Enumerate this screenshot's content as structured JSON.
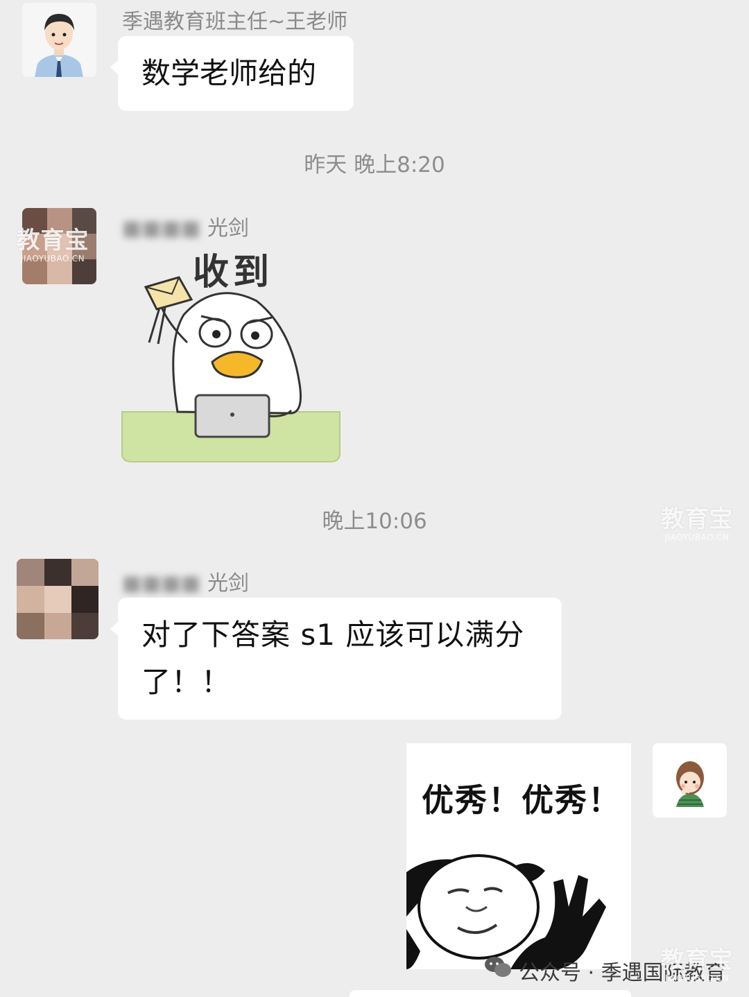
{
  "messages": [
    {
      "sender": "季遇教育班主任~王老师",
      "text": "数学老师给的"
    },
    {
      "sender_visible": "光剑",
      "sticker_caption": "收到"
    },
    {
      "sender_visible": "光剑",
      "text": "对了下答案 s1 应该可以满分了！！"
    },
    {
      "sticker_caption": "优秀！优秀！"
    }
  ],
  "timestamps": [
    "昨天 晚上8:20",
    "晚上10:06"
  ],
  "watermark": {
    "main": "教育宝",
    "sub": "JIAOYUBAO.CN"
  },
  "footer": {
    "source": "公众号 · 季遇国际教育"
  },
  "colors": {
    "background": "#ededed",
    "bubble": "#ffffff",
    "duck_desk": "#cfe3a3",
    "duck_beak": "#f5b82b"
  }
}
